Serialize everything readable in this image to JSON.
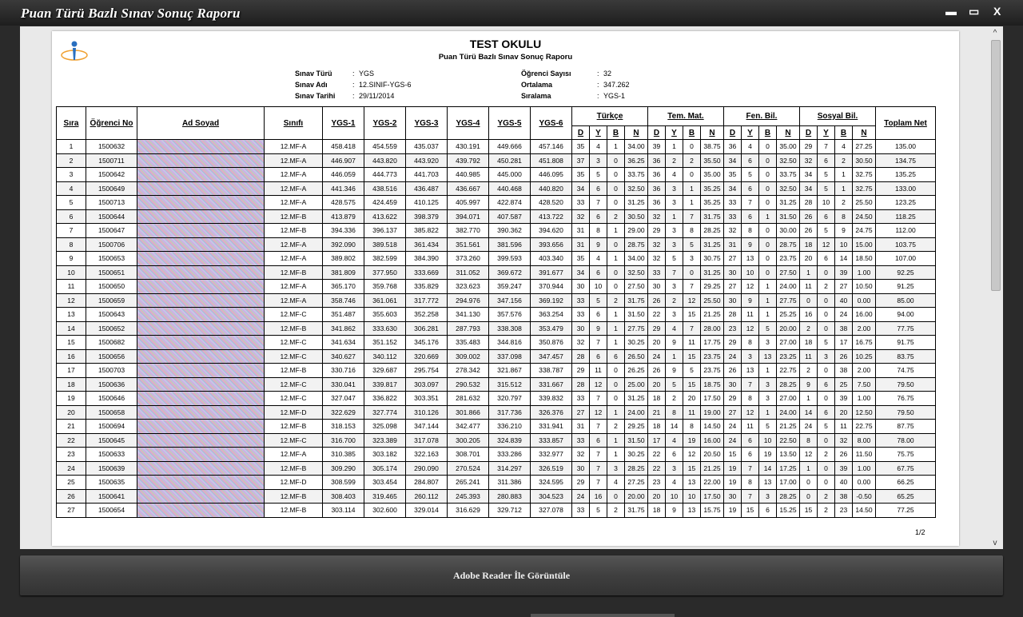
{
  "window": {
    "title": "Puan Türü Bazlı Sınav Sonuç Raporu",
    "min_label": "▬",
    "max_label": "▭",
    "close_label": "X"
  },
  "report": {
    "school": "TEST OKULU",
    "subtitle": "Puan Türü Bazlı Sınav Sonuç Raporu",
    "info_left": [
      {
        "key": "Sınav Türü",
        "value": "YGS"
      },
      {
        "key": "Sınav Adı",
        "value": "12.SINIF-YGS-6"
      },
      {
        "key": "Sınav Tarihi",
        "value": "29/11/2014"
      }
    ],
    "info_right": [
      {
        "key": "Öğrenci Sayısı",
        "value": "32"
      },
      {
        "key": "Ortalama",
        "value": "347.262"
      },
      {
        "key": "Sıralama",
        "value": "YGS-1"
      }
    ],
    "headers": {
      "sira": "Sıra",
      "ogrenci_no": "Öğrenci No",
      "ad_soyad": "Ad Soyad",
      "sinifi": "Sınıfı",
      "ygs1": "YGS-1",
      "ygs2": "YGS-2",
      "ygs3": "YGS-3",
      "ygs4": "YGS-4",
      "ygs5": "YGS-5",
      "ygs6": "YGS-6",
      "turkce": "Türkçe",
      "tem_mat": "Tem. Mat.",
      "fen_bil": "Fen. Bil.",
      "sosyal_bil": "Sosyal Bil.",
      "toplam_net": "Toplam Net",
      "d": "D",
      "y": "Y",
      "b": "B",
      "n": "N"
    },
    "rows": [
      [
        "1",
        "1500632",
        "12.MF-A",
        "458.418",
        "454.559",
        "435.037",
        "430.191",
        "449.666",
        "457.146",
        "35",
        "4",
        "1",
        "34.00",
        "39",
        "1",
        "0",
        "38.75",
        "36",
        "4",
        "0",
        "35.00",
        "29",
        "7",
        "4",
        "27.25",
        "135.00"
      ],
      [
        "2",
        "1500711",
        "12.MF-A",
        "446.907",
        "443.820",
        "443.920",
        "439.792",
        "450.281",
        "451.808",
        "37",
        "3",
        "0",
        "36.25",
        "36",
        "2",
        "2",
        "35.50",
        "34",
        "6",
        "0",
        "32.50",
        "32",
        "6",
        "2",
        "30.50",
        "134.75"
      ],
      [
        "3",
        "1500642",
        "12.MF-A",
        "446.059",
        "444.773",
        "441.703",
        "440.985",
        "445.000",
        "446.095",
        "35",
        "5",
        "0",
        "33.75",
        "36",
        "4",
        "0",
        "35.00",
        "35",
        "5",
        "0",
        "33.75",
        "34",
        "5",
        "1",
        "32.75",
        "135.25"
      ],
      [
        "4",
        "1500649",
        "12.MF-A",
        "441.346",
        "438.516",
        "436.487",
        "436.667",
        "440.468",
        "440.820",
        "34",
        "6",
        "0",
        "32.50",
        "36",
        "3",
        "1",
        "35.25",
        "34",
        "6",
        "0",
        "32.50",
        "34",
        "5",
        "1",
        "32.75",
        "133.00"
      ],
      [
        "5",
        "1500713",
        "12.MF-A",
        "428.575",
        "424.459",
        "410.125",
        "405.997",
        "422.874",
        "428.520",
        "33",
        "7",
        "0",
        "31.25",
        "36",
        "3",
        "1",
        "35.25",
        "33",
        "7",
        "0",
        "31.25",
        "28",
        "10",
        "2",
        "25.50",
        "123.25"
      ],
      [
        "6",
        "1500644",
        "12.MF-B",
        "413.879",
        "413.622",
        "398.379",
        "394.071",
        "407.587",
        "413.722",
        "32",
        "6",
        "2",
        "30.50",
        "32",
        "1",
        "7",
        "31.75",
        "33",
        "6",
        "1",
        "31.50",
        "26",
        "6",
        "8",
        "24.50",
        "118.25"
      ],
      [
        "7",
        "1500647",
        "12.MF-B",
        "394.336",
        "396.137",
        "385.822",
        "382.770",
        "390.362",
        "394.620",
        "31",
        "8",
        "1",
        "29.00",
        "29",
        "3",
        "8",
        "28.25",
        "32",
        "8",
        "0",
        "30.00",
        "26",
        "5",
        "9",
        "24.75",
        "112.00"
      ],
      [
        "8",
        "1500706",
        "12.MF-A",
        "392.090",
        "389.518",
        "361.434",
        "351.561",
        "381.596",
        "393.656",
        "31",
        "9",
        "0",
        "28.75",
        "32",
        "3",
        "5",
        "31.25",
        "31",
        "9",
        "0",
        "28.75",
        "18",
        "12",
        "10",
        "15.00",
        "103.75"
      ],
      [
        "9",
        "1500653",
        "12.MF-A",
        "389.802",
        "382.599",
        "384.390",
        "373.260",
        "399.593",
        "403.340",
        "35",
        "4",
        "1",
        "34.00",
        "32",
        "5",
        "3",
        "30.75",
        "27",
        "13",
        "0",
        "23.75",
        "20",
        "6",
        "14",
        "18.50",
        "107.00"
      ],
      [
        "10",
        "1500651",
        "12.MF-B",
        "381.809",
        "377.950",
        "333.669",
        "311.052",
        "369.672",
        "391.677",
        "34",
        "6",
        "0",
        "32.50",
        "33",
        "7",
        "0",
        "31.25",
        "30",
        "10",
        "0",
        "27.50",
        "1",
        "0",
        "39",
        "1.00",
        "92.25"
      ],
      [
        "11",
        "1500650",
        "12.MF-A",
        "365.170",
        "359.768",
        "335.829",
        "323.623",
        "359.247",
        "370.944",
        "30",
        "10",
        "0",
        "27.50",
        "30",
        "3",
        "7",
        "29.25",
        "27",
        "12",
        "1",
        "24.00",
        "11",
        "2",
        "27",
        "10.50",
        "91.25"
      ],
      [
        "12",
        "1500659",
        "12.MF-A",
        "358.746",
        "361.061",
        "317.772",
        "294.976",
        "347.156",
        "369.192",
        "33",
        "5",
        "2",
        "31.75",
        "26",
        "2",
        "12",
        "25.50",
        "30",
        "9",
        "1",
        "27.75",
        "0",
        "0",
        "40",
        "0.00",
        "85.00"
      ],
      [
        "13",
        "1500643",
        "12.MF-C",
        "351.487",
        "355.603",
        "352.258",
        "341.130",
        "357.576",
        "363.254",
        "33",
        "6",
        "1",
        "31.50",
        "22",
        "3",
        "15",
        "21.25",
        "28",
        "11",
        "1",
        "25.25",
        "16",
        "0",
        "24",
        "16.00",
        "94.00"
      ],
      [
        "14",
        "1500652",
        "12.MF-B",
        "341.862",
        "333.630",
        "306.281",
        "287.793",
        "338.308",
        "353.479",
        "30",
        "9",
        "1",
        "27.75",
        "29",
        "4",
        "7",
        "28.00",
        "23",
        "12",
        "5",
        "20.00",
        "2",
        "0",
        "38",
        "2.00",
        "77.75"
      ],
      [
        "15",
        "1500682",
        "12.MF-C",
        "341.634",
        "351.152",
        "345.176",
        "335.483",
        "344.816",
        "350.876",
        "32",
        "7",
        "1",
        "30.25",
        "20",
        "9",
        "11",
        "17.75",
        "29",
        "8",
        "3",
        "27.00",
        "18",
        "5",
        "17",
        "16.75",
        "91.75"
      ],
      [
        "16",
        "1500656",
        "12.MF-C",
        "340.627",
        "340.112",
        "320.669",
        "309.002",
        "337.098",
        "347.457",
        "28",
        "6",
        "6",
        "26.50",
        "24",
        "1",
        "15",
        "23.75",
        "24",
        "3",
        "13",
        "23.25",
        "11",
        "3",
        "26",
        "10.25",
        "83.75"
      ],
      [
        "17",
        "1500703",
        "12.MF-B",
        "330.716",
        "329.687",
        "295.754",
        "278.342",
        "321.867",
        "338.787",
        "29",
        "11",
        "0",
        "26.25",
        "26",
        "9",
        "5",
        "23.75",
        "26",
        "13",
        "1",
        "22.75",
        "2",
        "0",
        "38",
        "2.00",
        "74.75"
      ],
      [
        "18",
        "1500636",
        "12.MF-C",
        "330.041",
        "339.817",
        "303.097",
        "290.532",
        "315.512",
        "331.667",
        "28",
        "12",
        "0",
        "25.00",
        "20",
        "5",
        "15",
        "18.75",
        "30",
        "7",
        "3",
        "28.25",
        "9",
        "6",
        "25",
        "7.50",
        "79.50"
      ],
      [
        "19",
        "1500646",
        "12.MF-C",
        "327.047",
        "336.822",
        "303.351",
        "281.632",
        "320.797",
        "339.832",
        "33",
        "7",
        "0",
        "31.25",
        "18",
        "2",
        "20",
        "17.50",
        "29",
        "8",
        "3",
        "27.00",
        "1",
        "0",
        "39",
        "1.00",
        "76.75"
      ],
      [
        "20",
        "1500658",
        "12.MF-D",
        "322.629",
        "327.774",
        "310.126",
        "301.866",
        "317.736",
        "326.376",
        "27",
        "12",
        "1",
        "24.00",
        "21",
        "8",
        "11",
        "19.00",
        "27",
        "12",
        "1",
        "24.00",
        "14",
        "6",
        "20",
        "12.50",
        "79.50"
      ],
      [
        "21",
        "1500694",
        "12.MF-B",
        "318.153",
        "325.098",
        "347.144",
        "342.477",
        "336.210",
        "331.941",
        "31",
        "7",
        "2",
        "29.25",
        "18",
        "14",
        "8",
        "14.50",
        "24",
        "11",
        "5",
        "21.25",
        "24",
        "5",
        "11",
        "22.75",
        "87.75"
      ],
      [
        "22",
        "1500645",
        "12.MF-C",
        "316.700",
        "323.389",
        "317.078",
        "300.205",
        "324.839",
        "333.857",
        "33",
        "6",
        "1",
        "31.50",
        "17",
        "4",
        "19",
        "16.00",
        "24",
        "6",
        "10",
        "22.50",
        "8",
        "0",
        "32",
        "8.00",
        "78.00"
      ],
      [
        "23",
        "1500633",
        "12.MF-A",
        "310.385",
        "303.182",
        "322.163",
        "308.701",
        "333.286",
        "332.977",
        "32",
        "7",
        "1",
        "30.25",
        "22",
        "6",
        "12",
        "20.50",
        "15",
        "6",
        "19",
        "13.50",
        "12",
        "2",
        "26",
        "11.50",
        "75.75"
      ],
      [
        "24",
        "1500639",
        "12.MF-B",
        "309.290",
        "305.174",
        "290.090",
        "270.524",
        "314.297",
        "326.519",
        "30",
        "7",
        "3",
        "28.25",
        "22",
        "3",
        "15",
        "21.25",
        "19",
        "7",
        "14",
        "17.25",
        "1",
        "0",
        "39",
        "1.00",
        "67.75"
      ],
      [
        "25",
        "1500635",
        "12.MF-D",
        "308.599",
        "303.454",
        "284.807",
        "265.241",
        "311.386",
        "324.595",
        "29",
        "7",
        "4",
        "27.25",
        "23",
        "4",
        "13",
        "22.00",
        "19",
        "8",
        "13",
        "17.00",
        "0",
        "0",
        "40",
        "0.00",
        "66.25"
      ],
      [
        "26",
        "1500641",
        "12.MF-B",
        "308.403",
        "319.465",
        "260.112",
        "245.393",
        "280.883",
        "304.523",
        "24",
        "16",
        "0",
        "20.00",
        "20",
        "10",
        "10",
        "17.50",
        "30",
        "7",
        "3",
        "28.25",
        "0",
        "2",
        "38",
        "-0.50",
        "65.25"
      ],
      [
        "27",
        "1500654",
        "12.MF-B",
        "303.114",
        "302.600",
        "329.014",
        "316.629",
        "329.712",
        "327.078",
        "33",
        "5",
        "2",
        "31.75",
        "18",
        "9",
        "13",
        "15.75",
        "19",
        "15",
        "6",
        "15.25",
        "15",
        "2",
        "23",
        "14.50",
        "77.25"
      ]
    ],
    "page_label": "1/2"
  },
  "footer": {
    "button_label": "Adobe Reader İle Görüntüle"
  },
  "colors": {
    "background": "#2a2a2a",
    "viewer": "#e9e9e9",
    "row_alt": "#f2f2f2"
  }
}
